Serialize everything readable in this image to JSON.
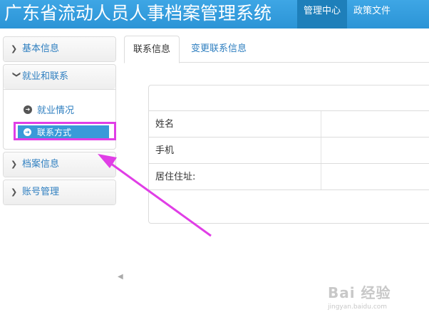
{
  "header": {
    "app_title": "广东省流动人员人事档案管理系统",
    "nav": [
      {
        "label": "管理中心",
        "active": true
      },
      {
        "label": "政策文件",
        "active": false
      }
    ]
  },
  "sidebar": {
    "sections": [
      {
        "label": "基本信息",
        "expanded": false
      },
      {
        "label": "就业和联系",
        "expanded": true,
        "items": [
          {
            "label": "就业情况",
            "active": false
          },
          {
            "label": "联系方式",
            "active": true
          }
        ]
      },
      {
        "label": "档案信息",
        "expanded": false
      },
      {
        "label": "账号管理",
        "expanded": false
      }
    ]
  },
  "tabs": [
    {
      "label": "联系信息",
      "active": true
    },
    {
      "label": "变更联系信息",
      "active": false
    }
  ],
  "contact_table": {
    "rows": [
      {
        "label": "姓名",
        "value": ""
      },
      {
        "label": "手机",
        "value": ""
      },
      {
        "label": "居住住址:",
        "value": ""
      }
    ]
  },
  "annotation": {
    "color": "#e03ee6"
  },
  "watermark": {
    "text": "Bai 经验",
    "sub": "jingyan.baidu.com"
  },
  "colors": {
    "header": "#2b94d6",
    "accent": "#3a9ad9",
    "link": "#2f7fc0"
  }
}
